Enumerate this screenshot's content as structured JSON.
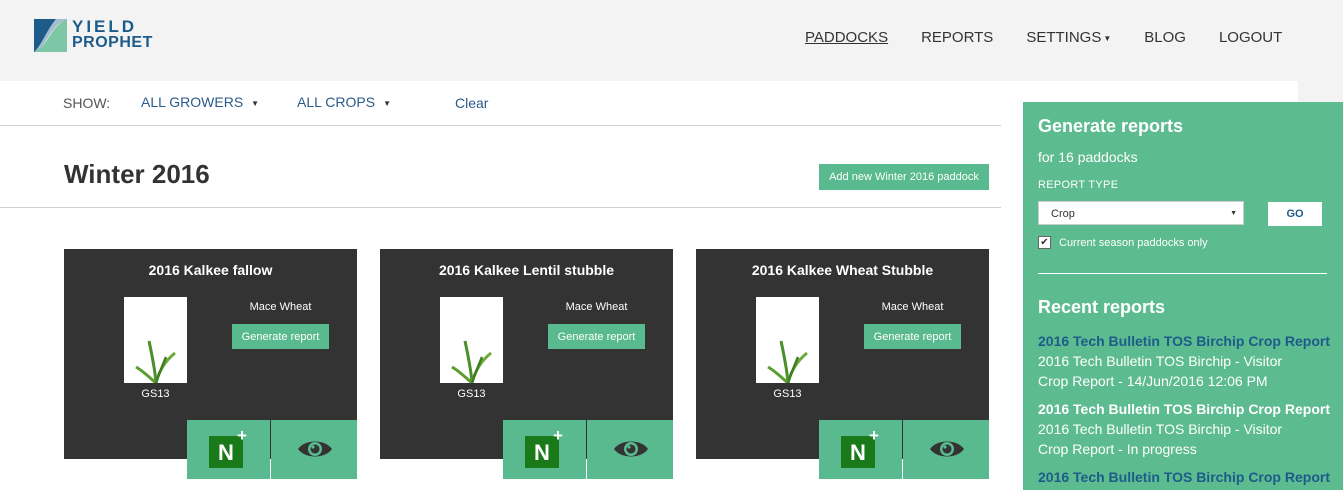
{
  "brand": {
    "line1": "YIELD",
    "line2": "PROPHET"
  },
  "nav": {
    "paddocks": "PADDOCKS",
    "reports": "REPORTS",
    "settings": "SETTINGS",
    "blog": "BLOG",
    "logout": "LOGOUT"
  },
  "filters": {
    "show_label": "SHOW:",
    "growers": "ALL GROWERS",
    "crops": "ALL CROPS",
    "clear": "Clear"
  },
  "page": {
    "title": "Winter 2016",
    "add_button": "Add new Winter 2016 paddock"
  },
  "cards": [
    {
      "title": "2016 Kalkee fallow",
      "crop": "Mace Wheat",
      "stage": "GS13",
      "button": "Generate report"
    },
    {
      "title": "2016 Kalkee Lentil stubble",
      "crop": "Mace Wheat",
      "stage": "GS13",
      "button": "Generate report"
    },
    {
      "title": "2016 Kalkee Wheat Stubble",
      "crop": "Mace Wheat",
      "stage": "GS13",
      "button": "Generate report"
    }
  ],
  "n_icon": {
    "letter": "N",
    "plus": "+"
  },
  "panel": {
    "title": "Generate reports",
    "subtitle": "for 16 paddocks",
    "report_type_label": "REPORT TYPE",
    "report_type_value": "Crop",
    "go": "GO",
    "checkbox_label": "Current season paddocks only",
    "checkbox_checked": true,
    "recent_title": "Recent reports",
    "reports": [
      {
        "title": "2016 Tech Bulletin TOS Birchip Crop Report",
        "line1": "2016 Tech Bulletin TOS Birchip - Visitor",
        "line2": "Crop Report - 14/Jun/2016 12:06 PM"
      },
      {
        "title": "2016 Tech Bulletin TOS Birchip Crop Report",
        "line1": "2016 Tech Bulletin TOS Birchip - Visitor",
        "line2": "Crop Report - In progress"
      },
      {
        "title": "2016 Tech Bulletin TOS Birchip Crop Report",
        "line1": "",
        "line2": ""
      }
    ]
  },
  "colors": {
    "accent_green": "#58ba8e",
    "panel_green": "#5cbb8f",
    "card_dark": "#333333",
    "link_blue": "#1d5c8a",
    "n_green": "#1a7a1a"
  }
}
